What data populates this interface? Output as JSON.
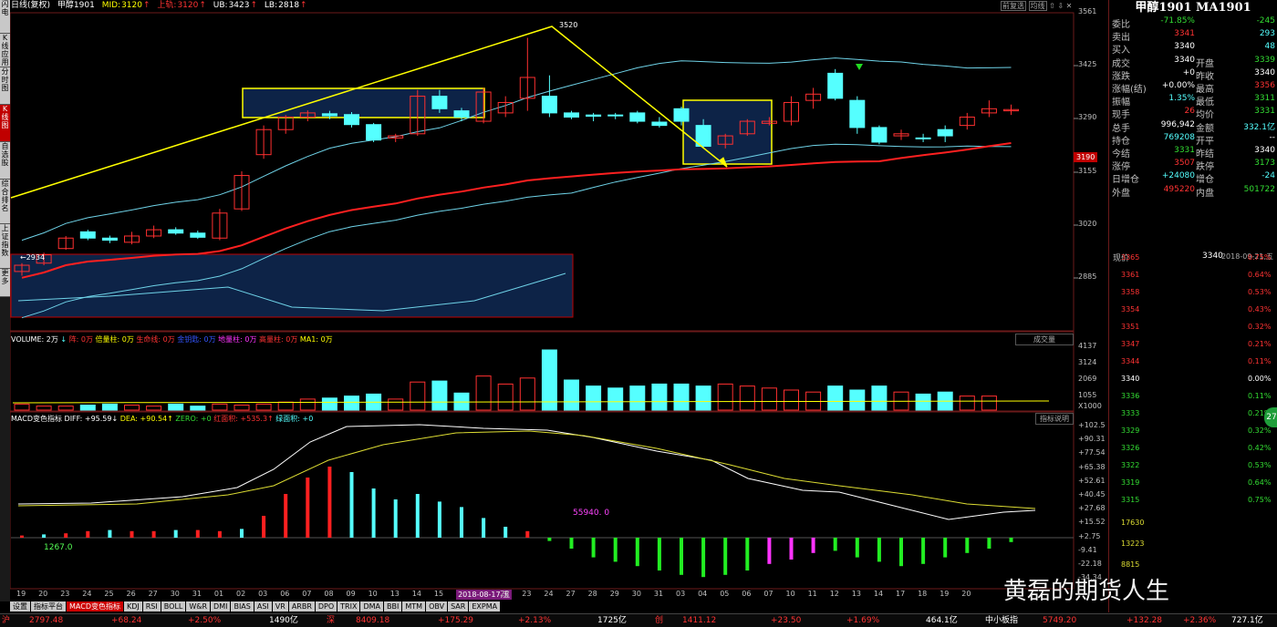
{
  "info_bar": {
    "period": "日线(复权)",
    "symbol": "甲醇1901",
    "mid_label": "MID:",
    "mid": "3120",
    "upper_label": "上轨:",
    "upper": "3120",
    "ub_label": "UB:",
    "ub": "3423",
    "lb_label": "LB:",
    "lb": "2818"
  },
  "toolbar_right": {
    "btn1": "前复选",
    "btn2": "均线",
    "icons": [
      "⇧",
      "⇩",
      "✕"
    ]
  },
  "left_tabs": [
    {
      "label": "分时图",
      "active": false
    },
    {
      "label": "K线图",
      "active": true
    },
    {
      "label": "自选股",
      "active": false
    },
    {
      "label": "综合排名",
      "active": false
    },
    {
      "label": "上证指数",
      "active": false
    },
    {
      "label": "更多",
      "active": false
    }
  ],
  "top_left_tabs": [
    "闪电",
    "K\n线\n应\n用"
  ],
  "price_axis": [
    "3561",
    "3425",
    "3290",
    "3155",
    "3020",
    "2885"
  ],
  "price_badge": "3190",
  "annotations": {
    "high": "3520",
    "low": "←2934"
  },
  "volume_legend": [
    {
      "t": "VOLUME: 2万",
      "c": "#ffffff"
    },
    {
      "t": "↓",
      "c": "#55ffff"
    },
    {
      "t": "阵: 0万",
      "c": "#ff3333"
    },
    {
      "t": "倍量柱: 0万",
      "c": "#ffff00"
    },
    {
      "t": "生命线: 0万",
      "c": "#ff3333"
    },
    {
      "t": "金钥匙: 0万",
      "c": "#3355ff"
    },
    {
      "t": "地量柱: 0万",
      "c": "#ff33ff"
    },
    {
      "t": "高量柱: 0万",
      "c": "#ff3333"
    },
    {
      "t": "MA1: 0万",
      "c": "#ffff00"
    }
  ],
  "volume_btn": "成交量",
  "volume_axis": [
    "4137",
    "3124",
    "2069",
    "1055",
    "X1000"
  ],
  "macd_legend": [
    {
      "t": "MACD变色指标",
      "c": "#ffffff"
    },
    {
      "t": "DIFF: +95.59↓",
      "c": "#ffffff"
    },
    {
      "t": "DEA: +90.54↑",
      "c": "#ffff00"
    },
    {
      "t": "ZERO: +0",
      "c": "#33dd33"
    },
    {
      "t": "红面积: +535.3↑",
      "c": "#ff3333"
    },
    {
      "t": "绿面积: +0",
      "c": "#55ffff"
    }
  ],
  "macd_btn": "指标说明",
  "macd_axis": [
    "+102.5",
    "+90.31",
    "+77.54",
    "+65.38",
    "+52.61",
    "+40.45",
    "+27.68",
    "+15.52",
    "+2.75",
    "-9.41",
    "-22.18",
    "-34.34"
  ],
  "macd_notes": {
    "left": "1267.0",
    "mid": "55940. 0"
  },
  "x_dates": [
    "19",
    "20",
    "23",
    "24",
    "25",
    "26",
    "27",
    "30",
    "31",
    "01",
    "02",
    "03",
    "06",
    "07",
    "08",
    "09",
    "10",
    "13",
    "14",
    "15",
    "16",
    "2018-08-17,五",
    "22",
    "23",
    "24",
    "27",
    "28",
    "29",
    "30",
    "31",
    "03",
    "04",
    "05",
    "06",
    "07",
    "10",
    "11",
    "12",
    "13",
    "14",
    "17",
    "18",
    "19",
    "20"
  ],
  "right_panel": {
    "title": "甲醇1901 MA1901",
    "quote_rows": [
      {
        "l": "委比",
        "v": "-71.85%",
        "vc": "#33dd33",
        "r": "",
        "rv": "-245",
        "rvc": "#33dd33"
      },
      {
        "l": "卖出",
        "v": "3341",
        "vc": "#ff3333",
        "r": "",
        "rv": "293",
        "rvc": "#55ffff"
      },
      {
        "l": "买入",
        "v": "3340",
        "vc": "#ffffff",
        "r": "",
        "rv": "48",
        "rvc": "#55ffff"
      },
      {
        "l": "成交",
        "v": "3340",
        "vc": "#ffffff",
        "r": "开盘",
        "rv": "3339",
        "rvc": "#33dd33"
      },
      {
        "l": "涨跌",
        "v": "+0",
        "vc": "#ffffff",
        "r": "昨收",
        "rv": "3340",
        "rvc": "#ffffff"
      },
      {
        "l": "涨幅(结)",
        "v": "+0.00%",
        "vc": "#ffffff",
        "r": "最高",
        "rv": "3356",
        "rvc": "#ff3333"
      },
      {
        "l": "振幅",
        "v": "1.35%",
        "vc": "#55ffff",
        "r": "最低",
        "rv": "3311",
        "rvc": "#33dd33"
      },
      {
        "l": "现手",
        "v": "26",
        "vc": "#ff3333",
        "r": "均价",
        "rv": "3331",
        "rvc": "#33dd33"
      },
      {
        "l": "总手",
        "v": "996,942",
        "vc": "#ffffff",
        "r": "金额",
        "rv": "332.1亿",
        "rvc": "#55ffff"
      },
      {
        "l": "持仓",
        "v": "769208",
        "vc": "#55ffff",
        "r": "开平",
        "rv": "--",
        "rvc": "#ffffff"
      },
      {
        "l": "今结",
        "v": "3331",
        "vc": "#33dd33",
        "r": "昨结",
        "rv": "3340",
        "rvc": "#ffffff"
      },
      {
        "l": "涨停",
        "v": "3507",
        "vc": "#ff3333",
        "r": "跌停",
        "rv": "3173",
        "rvc": "#33dd33"
      },
      {
        "l": "日增仓",
        "v": "+24080",
        "vc": "#55ffff",
        "r": "增仓",
        "rv": "-24",
        "rvc": "#55ffff"
      },
      {
        "l": "外盘",
        "v": "495220",
        "vc": "#ff3333",
        "r": "内盘",
        "rv": "501722",
        "rvc": "#33dd33"
      }
    ],
    "now_label": "现价",
    "now_value": "3340",
    "now_time": "2018-09-21,五",
    "mini_left": [
      "3365",
      "3361",
      "3358",
      "3354",
      "3351",
      "3347",
      "3344",
      "3340",
      "3336",
      "3333",
      "3329",
      "3326",
      "3322",
      "3319",
      "3315"
    ],
    "mini_right": [
      "0.75%",
      "0.64%",
      "0.53%",
      "0.43%",
      "0.32%",
      "0.21%",
      "0.11%",
      "0.00%",
      "0.11%",
      "0.21%",
      "0.32%",
      "0.42%",
      "0.53%",
      "0.64%",
      "0.75%"
    ],
    "mini_vol": [
      "17630",
      "13223",
      "8815"
    ],
    "side_badge": "27"
  },
  "bottom_tabs": [
    "设置",
    "指标平台",
    "MACD变色指标",
    "KDJ",
    "RSI",
    "BOLL",
    "W&R",
    "DMI",
    "BIAS",
    "ASI",
    "VR",
    "ARBR",
    "DPO",
    "TRIX",
    "DMA",
    "BBI",
    "MTM",
    "OBV",
    "SAR",
    "EXPMA"
  ],
  "status_bar": [
    {
      "t": "沪",
      "c": "#ff3333"
    },
    {
      "t": "2797.48",
      "c": "#ff3333"
    },
    {
      "t": "+68.24",
      "c": "#ff3333"
    },
    {
      "t": "+2.50%",
      "c": "#ff3333"
    },
    {
      "t": "1490亿",
      "c": "#ffffff"
    },
    {
      "t": "深",
      "c": "#ff3333"
    },
    {
      "t": "8409.18",
      "c": "#ff3333"
    },
    {
      "t": "+175.29",
      "c": "#ff3333"
    },
    {
      "t": "+2.13%",
      "c": "#ff3333"
    },
    {
      "t": "1725亿",
      "c": "#ffffff"
    },
    {
      "t": "创",
      "c": "#ff3333"
    },
    {
      "t": "1411.12",
      "c": "#ff3333"
    },
    {
      "t": "+23.50",
      "c": "#ff3333"
    },
    {
      "t": "+1.69%",
      "c": "#ff3333"
    },
    {
      "t": "464.1亿",
      "c": "#ffffff"
    },
    {
      "t": "中小板指",
      "c": "#ffffff"
    },
    {
      "t": "5749.20",
      "c": "#ff3333"
    },
    {
      "t": "+132.28",
      "c": "#ff3333"
    },
    {
      "t": "+2.36%",
      "c": "#ff3333"
    },
    {
      "t": "727.1亿",
      "c": "#ffffff"
    }
  ],
  "watermark": "黄磊的期货人生",
  "chart_data": {
    "type": "candlestick",
    "price_range": [
      2820,
      3580
    ],
    "candles": [
      [
        2960,
        2975,
        2950,
        2980
      ],
      [
        2980,
        3000,
        2975,
        3005
      ],
      [
        3015,
        3040,
        3012,
        3045
      ],
      [
        3055,
        3040,
        3035,
        3060
      ],
      [
        3040,
        3035,
        3028,
        3046
      ],
      [
        3030,
        3045,
        3025,
        3055
      ],
      [
        3045,
        3060,
        3040,
        3070
      ],
      [
        3060,
        3052,
        3048,
        3066
      ],
      [
        3052,
        3042,
        3038,
        3058
      ],
      [
        3040,
        3100,
        3035,
        3110
      ],
      [
        3110,
        3190,
        3105,
        3200
      ],
      [
        3240,
        3300,
        3230,
        3310
      ],
      [
        3300,
        3330,
        3290,
        3335
      ],
      [
        3330,
        3340,
        3320,
        3346
      ],
      [
        3338,
        3333,
        3325,
        3345
      ],
      [
        3336,
        3312,
        3305,
        3342
      ],
      [
        3312,
        3275,
        3270,
        3316
      ],
      [
        3280,
        3285,
        3270,
        3290
      ],
      [
        3290,
        3380,
        3285,
        3395
      ],
      [
        3380,
        3350,
        3340,
        3395
      ],
      [
        3345,
        3330,
        3320,
        3352
      ],
      [
        3320,
        3390,
        3315,
        3400
      ],
      [
        3340,
        3365,
        3330,
        3380
      ],
      [
        3375,
        3425,
        3345,
        3520
      ],
      [
        3380,
        3340,
        3330,
        3430
      ],
      [
        3340,
        3330,
        3325,
        3345
      ],
      [
        3335,
        3332,
        3320,
        3340
      ],
      [
        3335,
        3333,
        3325,
        3340
      ],
      [
        3340,
        3320,
        3315,
        3345
      ],
      [
        3318,
        3310,
        3305,
        3330
      ],
      [
        3350,
        3320,
        3310,
        3355
      ],
      [
        3310,
        3260,
        3255,
        3325
      ],
      [
        3265,
        3285,
        3255,
        3290
      ],
      [
        3290,
        3320,
        3285,
        3325
      ],
      [
        3315,
        3320,
        3310,
        3330
      ],
      [
        3320,
        3365,
        3310,
        3380
      ],
      [
        3370,
        3385,
        3350,
        3400
      ],
      [
        3435,
        3375,
        3370,
        3445
      ],
      [
        3370,
        3305,
        3290,
        3380
      ],
      [
        3305,
        3270,
        3265,
        3310
      ],
      [
        3285,
        3290,
        3275,
        3300
      ],
      [
        3280,
        3278,
        3270,
        3290
      ],
      [
        3300,
        3285,
        3270,
        3310
      ],
      [
        3310,
        3330,
        3300,
        3340
      ],
      [
        3340,
        3350,
        3330,
        3370
      ],
      [
        3345,
        3348,
        3335,
        3360
      ]
    ],
    "volume": [
      0.3,
      0.2,
      0.2,
      0.25,
      0.3,
      0.25,
      0.2,
      0.3,
      0.2,
      0.3,
      0.25,
      0.3,
      0.4,
      0.55,
      0.6,
      0.7,
      0.8,
      0.55,
      1.4,
      1.45,
      0.85,
      1.7,
      1.3,
      1.6,
      3.0,
      1.5,
      1.2,
      1.1,
      1.2,
      1.3,
      1.3,
      1.2,
      1.3,
      1.2,
      1.1,
      1.0,
      0.9,
      1.2,
      1.0,
      1.2,
      0.9,
      0.8,
      0.9,
      0.7,
      0.7
    ],
    "macd": [
      2,
      3,
      4,
      6,
      7,
      6,
      6,
      7,
      7,
      6,
      8,
      20,
      40,
      55,
      65,
      60,
      45,
      35,
      40,
      33,
      28,
      18,
      10,
      6,
      -3,
      -10,
      -18,
      -22,
      -26,
      -30,
      -34,
      -36,
      -34,
      -30,
      -24,
      -20,
      -14,
      -12,
      -18,
      -22,
      -26,
      -24,
      -18,
      -14,
      -10,
      -4
    ]
  }
}
